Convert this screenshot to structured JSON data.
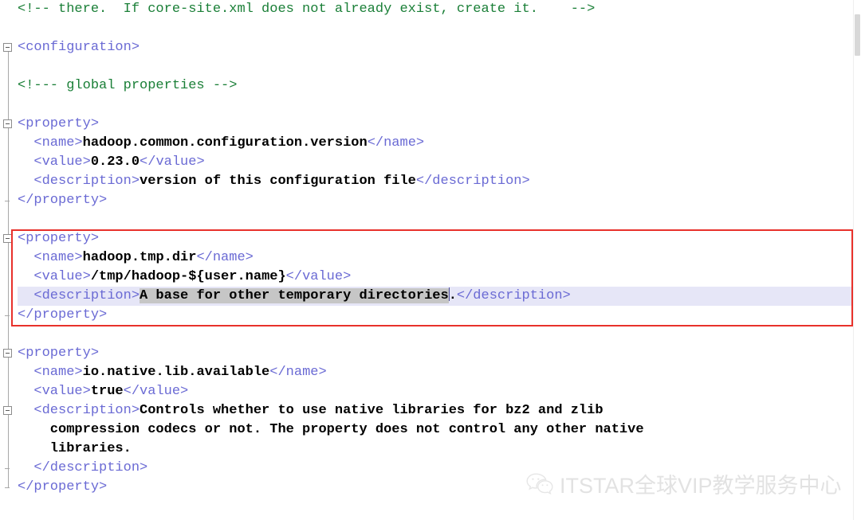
{
  "editor": {
    "app_kind": "xml-code-editor",
    "file_context": "core-site.xml",
    "colors": {
      "tag": "#6a6ad4",
      "comment": "#1a7f37",
      "content": "#000000",
      "background": "#ffffff",
      "current_line_highlight": "#e6e6f7",
      "selection": "#c6c6c6",
      "annotation_rect": "#e8312b",
      "gutter_line": "#a8a8a8"
    },
    "lines": [
      {
        "n": 1,
        "segments": [
          {
            "kind": "comment",
            "text": "<!-- there.  If core-site.xml does not already exist, create it.    -->"
          }
        ]
      },
      {
        "n": 2,
        "segments": []
      },
      {
        "n": 3,
        "segments": [
          {
            "kind": "tag",
            "text": "<configuration>"
          }
        ]
      },
      {
        "n": 4,
        "segments": []
      },
      {
        "n": 5,
        "segments": [
          {
            "kind": "comment",
            "text": "<!--- global properties -->"
          }
        ]
      },
      {
        "n": 6,
        "segments": []
      },
      {
        "n": 7,
        "segments": [
          {
            "kind": "tag",
            "text": "<property>"
          }
        ]
      },
      {
        "n": 8,
        "segments": [
          {
            "kind": "tag",
            "text": "  <name>"
          },
          {
            "kind": "content",
            "text": "hadoop.common.configuration.version"
          },
          {
            "kind": "tag",
            "text": "</name>"
          }
        ]
      },
      {
        "n": 9,
        "segments": [
          {
            "kind": "tag",
            "text": "  <value>"
          },
          {
            "kind": "content",
            "text": "0.23.0"
          },
          {
            "kind": "tag",
            "text": "</value>"
          }
        ]
      },
      {
        "n": 10,
        "segments": [
          {
            "kind": "tag",
            "text": "  <description>"
          },
          {
            "kind": "content",
            "text": "version of this configuration file"
          },
          {
            "kind": "tag",
            "text": "</description>"
          }
        ]
      },
      {
        "n": 11,
        "segments": [
          {
            "kind": "tag",
            "text": "</property>"
          }
        ]
      },
      {
        "n": 12,
        "segments": []
      },
      {
        "n": 13,
        "segments": [
          {
            "kind": "tag",
            "text": "<property>"
          }
        ]
      },
      {
        "n": 14,
        "segments": [
          {
            "kind": "tag",
            "text": "  <name>"
          },
          {
            "kind": "content",
            "text": "hadoop.tmp.dir"
          },
          {
            "kind": "tag",
            "text": "</name>"
          }
        ]
      },
      {
        "n": 15,
        "segments": [
          {
            "kind": "tag",
            "text": "  <value>"
          },
          {
            "kind": "content",
            "text": "/tmp/hadoop-${user.name}"
          },
          {
            "kind": "tag",
            "text": "</value>"
          }
        ]
      },
      {
        "n": 16,
        "segments": [
          {
            "kind": "tag",
            "text": "  <description>"
          },
          {
            "kind": "content-selected",
            "text": "A base for other temporary directories"
          },
          {
            "kind": "caret",
            "text": ""
          },
          {
            "kind": "content",
            "text": "."
          },
          {
            "kind": "tag",
            "text": "</description>"
          }
        ]
      },
      {
        "n": 17,
        "segments": [
          {
            "kind": "tag",
            "text": "</property>"
          }
        ]
      },
      {
        "n": 18,
        "segments": []
      },
      {
        "n": 19,
        "segments": [
          {
            "kind": "tag",
            "text": "<property>"
          }
        ]
      },
      {
        "n": 20,
        "segments": [
          {
            "kind": "tag",
            "text": "  <name>"
          },
          {
            "kind": "content",
            "text": "io.native.lib.available"
          },
          {
            "kind": "tag",
            "text": "</name>"
          }
        ]
      },
      {
        "n": 21,
        "segments": [
          {
            "kind": "tag",
            "text": "  <value>"
          },
          {
            "kind": "content",
            "text": "true"
          },
          {
            "kind": "tag",
            "text": "</value>"
          }
        ]
      },
      {
        "n": 22,
        "segments": [
          {
            "kind": "tag",
            "text": "  <description>"
          },
          {
            "kind": "content",
            "text": "Controls whether to use native libraries for bz2 and zlib"
          }
        ]
      },
      {
        "n": 23,
        "segments": [
          {
            "kind": "content",
            "text": "    compression codecs or not. The property does not control any other native"
          }
        ]
      },
      {
        "n": 24,
        "segments": [
          {
            "kind": "content",
            "text": "    libraries."
          }
        ]
      },
      {
        "n": 25,
        "segments": [
          {
            "kind": "tag",
            "text": "  </description>"
          }
        ]
      },
      {
        "n": 26,
        "segments": [
          {
            "kind": "tag",
            "text": "</property>"
          }
        ]
      }
    ],
    "current_line": 16,
    "selection_text": "A base for other temporary directories",
    "fold_markers": [
      {
        "line": 3,
        "type": "collapse-box"
      },
      {
        "line": 7,
        "type": "collapse-box"
      },
      {
        "line": 11,
        "type": "fold-end"
      },
      {
        "line": 13,
        "type": "collapse-box"
      },
      {
        "line": 17,
        "type": "fold-end"
      },
      {
        "line": 19,
        "type": "collapse-box"
      },
      {
        "line": 22,
        "type": "collapse-box"
      },
      {
        "line": 25,
        "type": "fold-end"
      },
      {
        "line": 26,
        "type": "fold-end"
      }
    ],
    "annotation": {
      "shape": "rectangle",
      "color": "#e8312b",
      "covers_lines": [
        13,
        14,
        15,
        16,
        17
      ]
    }
  },
  "watermark": {
    "icon": "wechat-icon",
    "text": "ITSTAR全球VIP教学服务中心"
  },
  "scrollbar": {
    "orientation": "vertical",
    "position": "right"
  }
}
